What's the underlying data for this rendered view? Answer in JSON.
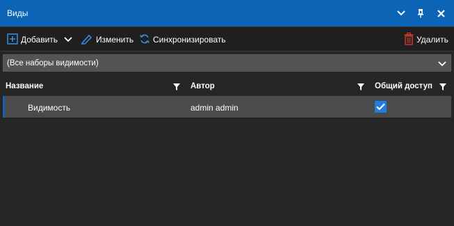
{
  "window": {
    "title": "Виды"
  },
  "toolbar": {
    "add_label": "Добавить",
    "edit_label": "Изменить",
    "sync_label": "Синхронизировать",
    "delete_label": "Удалить"
  },
  "filter": {
    "selected": "(Все наборы видимости)"
  },
  "table": {
    "columns": [
      "Название",
      "Автор",
      "Общий доступ"
    ],
    "rows": [
      {
        "name": "Видимость",
        "author": "admin admin",
        "shared": true
      }
    ]
  },
  "colors": {
    "titlebar": "#0b64b5",
    "accent": "#1f7ee0",
    "selected_row": "#4b4b4b",
    "background": "#262626"
  }
}
